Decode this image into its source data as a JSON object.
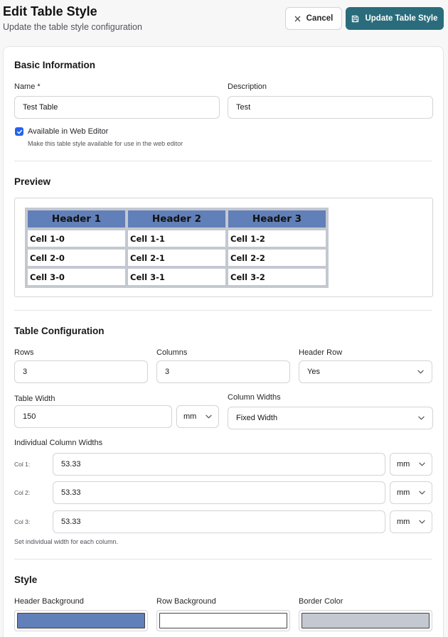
{
  "header": {
    "title": "Edit Table Style",
    "subtitle": "Update the table style configuration",
    "cancel_label": "Cancel",
    "update_label": "Update Table Style"
  },
  "basic": {
    "title": "Basic Information",
    "name_label": "Name *",
    "name_value": "Test Table",
    "description_label": "Description",
    "description_value": "Test",
    "web_editor_label": "Available in Web Editor",
    "web_editor_checked": true,
    "web_editor_hint": "Make this table style available for use in the web editor"
  },
  "preview": {
    "title": "Preview",
    "headers": [
      "Header 1",
      "Header 2",
      "Header 3"
    ],
    "rows": [
      [
        "Cell 1-0",
        "Cell 1-1",
        "Cell 1-2"
      ],
      [
        "Cell 2-0",
        "Cell 2-1",
        "Cell 2-2"
      ],
      [
        "Cell 3-0",
        "Cell 3-1",
        "Cell 3-2"
      ]
    ]
  },
  "config": {
    "title": "Table Configuration",
    "rows_label": "Rows",
    "rows_value": "3",
    "columns_label": "Columns",
    "columns_value": "3",
    "header_row_label": "Header Row",
    "header_row_value": "Yes",
    "width_label": "Table Width",
    "width_value": "150",
    "width_unit": "mm",
    "col_widths_label": "Column Widths",
    "col_widths_value": "Fixed Width",
    "individual_label": "Individual Column Widths",
    "columns": [
      {
        "label": "Col 1:",
        "value": "53.33",
        "unit": "mm"
      },
      {
        "label": "Col 2:",
        "value": "53.33",
        "unit": "mm"
      },
      {
        "label": "Col 3:",
        "value": "53.33",
        "unit": "mm"
      }
    ],
    "individual_hint": "Set individual width for each column."
  },
  "style": {
    "title": "Style",
    "header_bg_label": "Header Background",
    "header_bg_color": "#617fb8",
    "row_bg_label": "Row Background",
    "row_bg_color": "#ffffff",
    "border_color_label": "Border Color",
    "border_color": "#c4c8d0"
  },
  "colors": {
    "accent": "#2a6c7c",
    "checkbox": "#2563eb"
  }
}
